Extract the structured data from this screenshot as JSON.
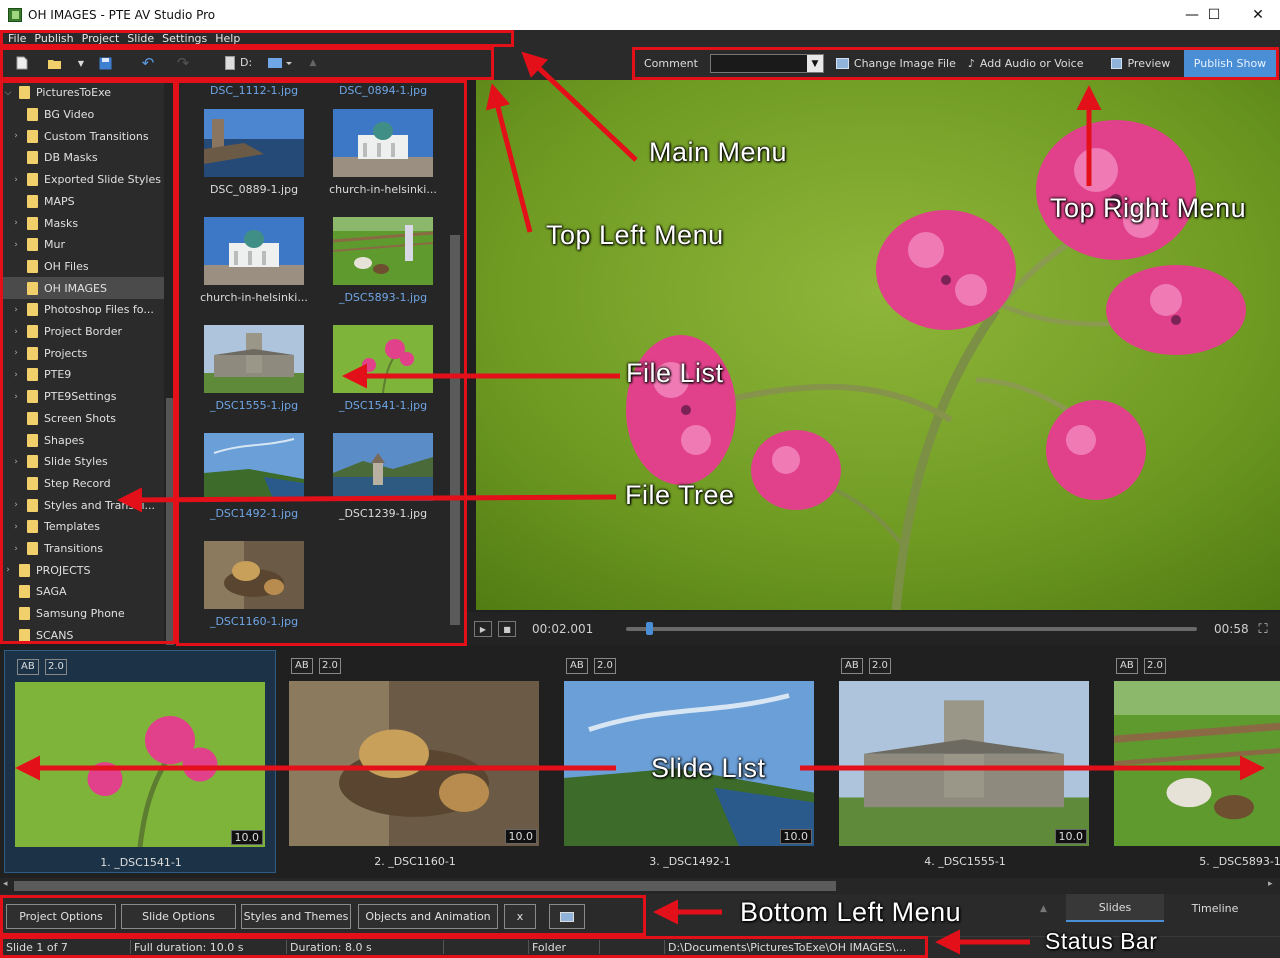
{
  "window": {
    "title": "OH IMAGES - PTE AV Studio Pro",
    "minimize": "—",
    "maximize": "☐",
    "close": "✕"
  },
  "menu": [
    "File",
    "Publish",
    "Project",
    "Slide",
    "Settings",
    "Help"
  ],
  "toolbar": {
    "drive": "D:"
  },
  "top_right": {
    "comment_label": "Comment",
    "comment_value": "",
    "change_image": "Change Image File",
    "add_audio": "Add Audio or Voice",
    "preview": "Preview",
    "publish": "Publish Show"
  },
  "tree": [
    {
      "label": "PicturesToExe",
      "chev": "⌵",
      "indent": 1
    },
    {
      "label": "BG Video",
      "chev": "",
      "indent": 2
    },
    {
      "label": "Custom Transitions",
      "chev": "›",
      "indent": 2
    },
    {
      "label": "DB Masks",
      "chev": "",
      "indent": 2
    },
    {
      "label": "Exported Slide Styles",
      "chev": "›",
      "indent": 2
    },
    {
      "label": "MAPS",
      "chev": "",
      "indent": 2
    },
    {
      "label": "Masks",
      "chev": "›",
      "indent": 2
    },
    {
      "label": "Mur",
      "chev": "›",
      "indent": 2
    },
    {
      "label": "OH Files",
      "chev": "",
      "indent": 2
    },
    {
      "label": "OH IMAGES",
      "chev": "",
      "indent": 2,
      "selected": true
    },
    {
      "label": "Photoshop Files fo...",
      "chev": "›",
      "indent": 2
    },
    {
      "label": "Project Border",
      "chev": "›",
      "indent": 2
    },
    {
      "label": "Projects",
      "chev": "›",
      "indent": 2
    },
    {
      "label": "PTE9",
      "chev": "›",
      "indent": 2
    },
    {
      "label": "PTE9Settings",
      "chev": "›",
      "indent": 2
    },
    {
      "label": "Screen Shots",
      "chev": "",
      "indent": 2
    },
    {
      "label": "Shapes",
      "chev": "",
      "indent": 2
    },
    {
      "label": "Slide Styles",
      "chev": "›",
      "indent": 2
    },
    {
      "label": "Step Record",
      "chev": "",
      "indent": 2
    },
    {
      "label": "Styles and Transiti...",
      "chev": "›",
      "indent": 2
    },
    {
      "label": "Templates",
      "chev": "›",
      "indent": 2
    },
    {
      "label": "Transitions",
      "chev": "›",
      "indent": 2
    },
    {
      "label": "PROJECTS",
      "chev": "›",
      "indent": 1
    },
    {
      "label": "SAGA",
      "chev": "",
      "indent": 1
    },
    {
      "label": "Samsung Phone",
      "chev": "",
      "indent": 1
    },
    {
      "label": "SCANS",
      "chev": "",
      "indent": 1
    }
  ],
  "files": {
    "top_partial": [
      "DSC_1112-1.jpg",
      "DSC_0894-1.jpg"
    ],
    "items": [
      {
        "name": "DSC_0889-1.jpg",
        "blue": false,
        "kind": "lake"
      },
      {
        "name": "church-in-helsinki...",
        "blue": false,
        "kind": "church"
      },
      {
        "name": "church-in-helsinki...",
        "blue": false,
        "kind": "church"
      },
      {
        "name": "_DSC5893-1.jpg",
        "blue": true,
        "kind": "goats"
      },
      {
        "name": "_DSC1555-1.jpg",
        "blue": true,
        "kind": "cathedral"
      },
      {
        "name": "_DSC1541-1.jpg",
        "blue": true,
        "kind": "flower"
      },
      {
        "name": "_DSC1492-1.jpg",
        "blue": true,
        "kind": "coast"
      },
      {
        "name": "_DSC1239-1.jpg",
        "blue": false,
        "kind": "tower"
      },
      {
        "name": "_DSC1160-1.jpg",
        "blue": true,
        "kind": "statue"
      }
    ]
  },
  "player": {
    "current": "00:02.001",
    "total": "00:58",
    "progress": 0.04
  },
  "slides": [
    {
      "ab": "AB",
      "dur": "2.0",
      "len": "10.0",
      "caption": "1. _DSC1541-1",
      "kind": "flower",
      "selected": true
    },
    {
      "ab": "AB",
      "dur": "2.0",
      "len": "10.0",
      "caption": "2. _DSC1160-1",
      "kind": "statue"
    },
    {
      "ab": "AB",
      "dur": "2.0",
      "len": "10.0",
      "caption": "3. _DSC1492-1",
      "kind": "coast"
    },
    {
      "ab": "AB",
      "dur": "2.0",
      "len": "10.0",
      "caption": "4. _DSC1555-1",
      "kind": "cathedral"
    },
    {
      "ab": "AB",
      "dur": "2.0",
      "len": "",
      "caption": "5. _DSC5893-1",
      "kind": "goats"
    }
  ],
  "bottom": {
    "project_options": "Project Options",
    "slide_options": "Slide Options",
    "styles_themes": "Styles and Themes",
    "objects_animation": "Objects and Animation",
    "x": "x",
    "tab_slides": "Slides",
    "tab_timeline": "Timeline"
  },
  "status": {
    "slide": "Slide 1 of 7",
    "full_duration": "Full duration: 10.0 s",
    "duration": "Duration: 8.0 s",
    "folder": "Folder",
    "path": "D:\\Documents\\PicturesToExe\\OH IMAGES\\..."
  },
  "annotations": {
    "main_menu": "Main Menu",
    "top_left_menu": "Top Left Menu",
    "top_right_menu": "Top Right Menu",
    "file_list": "File List",
    "file_tree": "File Tree",
    "slide_list": "Slide List",
    "bottom_left_menu": "Bottom Left Menu",
    "status_bar": "Status Bar"
  },
  "colors": {
    "accent": "#4a8fd6",
    "annotation": "#e3101a",
    "folder": "#f1cf6a"
  }
}
